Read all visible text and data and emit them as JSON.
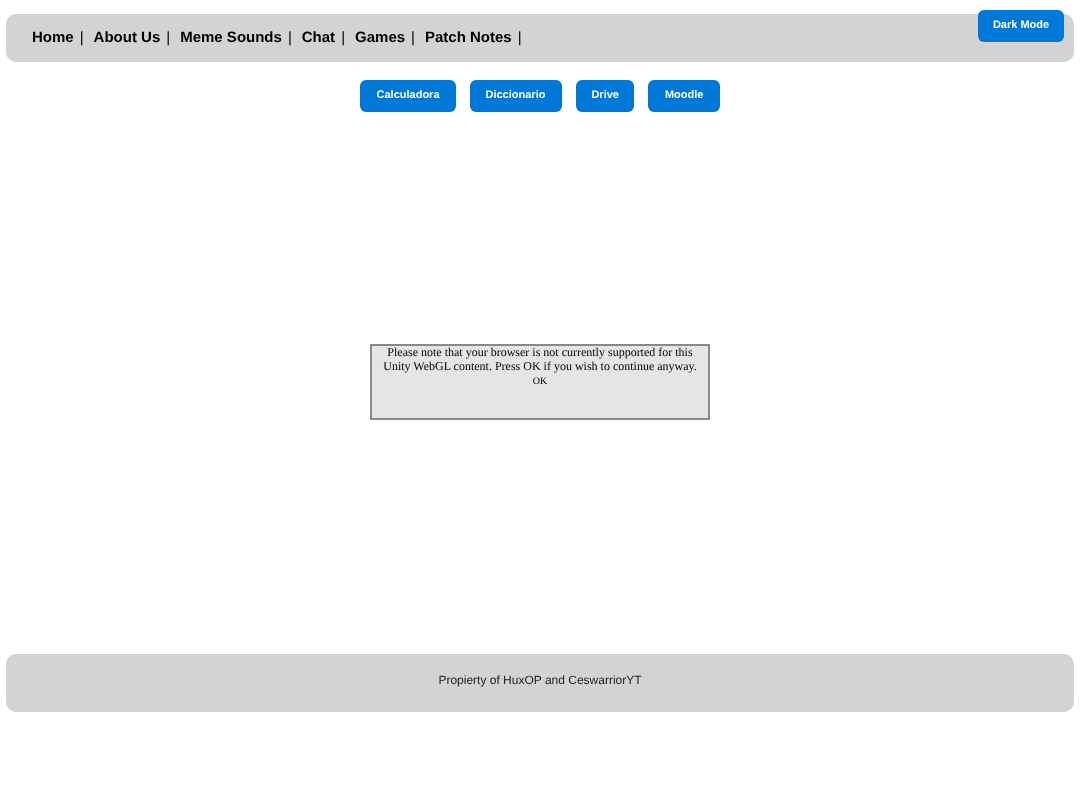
{
  "nav": {
    "items": [
      {
        "label": "Home",
        "separator": "|"
      },
      {
        "label": "About Us",
        "separator": "|"
      },
      {
        "label": "Meme Sounds",
        "separator": "|"
      },
      {
        "label": "Chat",
        "separator": "|"
      },
      {
        "label": "Games",
        "separator": "|"
      },
      {
        "label": "Patch Notes",
        "separator": "|"
      }
    ],
    "theme_button": "Dark Mode"
  },
  "links": [
    "Calculadora",
    "Diccionario",
    "Drive",
    "Moodle"
  ],
  "notice": {
    "message": "Please note that your browser is not currently supported for this Unity WebGL content. Press OK if you wish to continue anyway.",
    "button": "OK"
  },
  "footer": "Propierty of HuxOP and CeswarriorYT"
}
